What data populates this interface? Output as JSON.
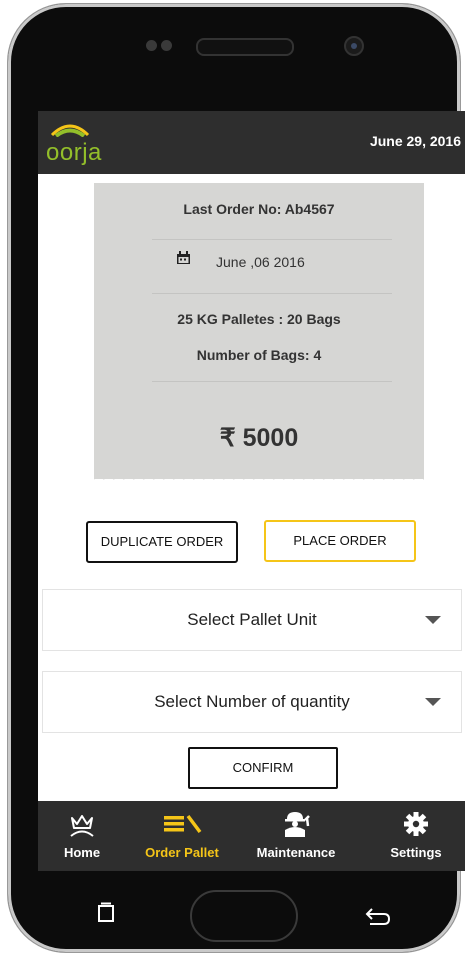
{
  "header": {
    "logo_text": "oorja",
    "date": "June 29, 2016"
  },
  "receipt": {
    "last_order": "Last Order No: Ab4567",
    "order_date": "June ,06 2016",
    "pallet_info": "25 KG Palletes : 20 Bags",
    "bags_count": "Number of Bags: 4",
    "amount": "₹ 5000"
  },
  "actions": {
    "duplicate_label": "DUPLICATE ORDER",
    "place_label": "PLACE ORDER",
    "confirm_label": "CONFIRM"
  },
  "selects": {
    "pallet_unit": "Select Pallet Unit",
    "quantity": "Select Number of quantity"
  },
  "nav": {
    "items": [
      {
        "label": "Home",
        "icon": "home-crown-icon"
      },
      {
        "label": "Order Pallet",
        "icon": "order-pallet-icon"
      },
      {
        "label": "Maintenance",
        "icon": "maintenance-worker-icon"
      },
      {
        "label": "Settings",
        "icon": "gear-icon"
      }
    ],
    "active_index": 1
  },
  "colors": {
    "appbar": "#2e2e2e",
    "accent": "#f5c518",
    "logo_green": "#93bf2a",
    "receipt_bg": "#d6d6d4"
  }
}
